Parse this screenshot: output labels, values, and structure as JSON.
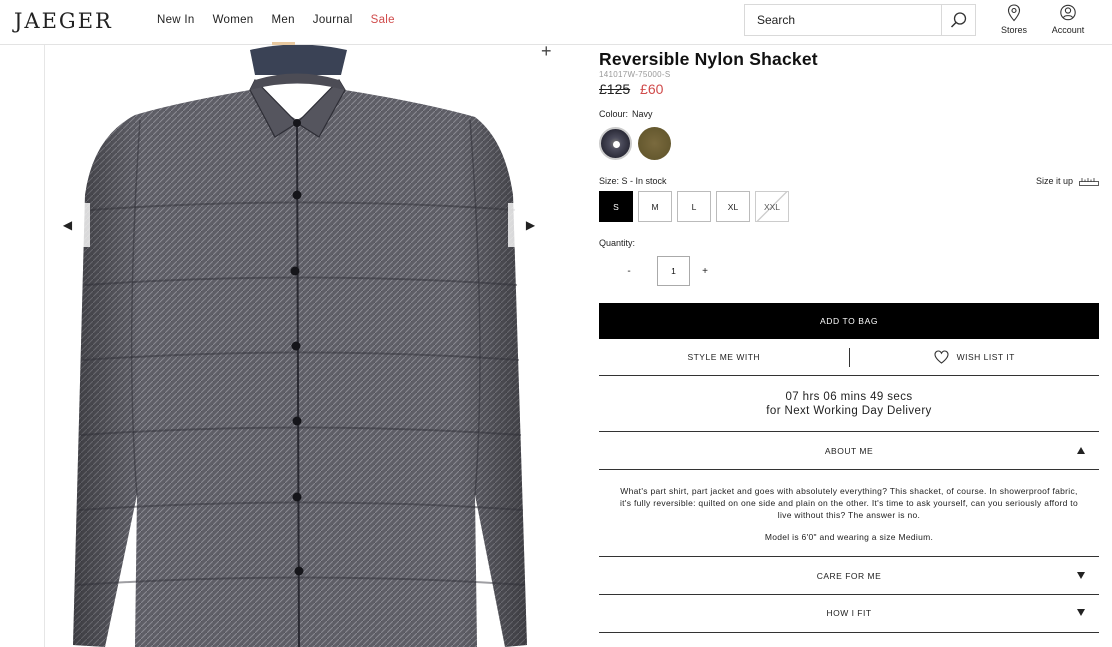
{
  "header": {
    "logo": "JAEGER",
    "nav": [
      {
        "label": "New In"
      },
      {
        "label": "Women"
      },
      {
        "label": "Men",
        "active": true
      },
      {
        "label": "Journal"
      },
      {
        "label": "Sale",
        "sale": true
      }
    ],
    "search_placeholder": "Search",
    "stores_label": "Stores",
    "account_label": "Account"
  },
  "gallery": {
    "prev_icon": "caret-left-icon",
    "next_icon": "caret-right-icon",
    "zoom_icon": "plus-icon"
  },
  "product": {
    "title": "Reversible Nylon Shacket",
    "sku": "141017W-75000-S",
    "price_old": "£125",
    "price_new": "£60",
    "colour_label": "Colour:",
    "colour_value": "Navy",
    "size_label": "Size: S - In stock",
    "size_it_up": "Size it up",
    "sizes": [
      "S",
      "M",
      "L",
      "XL",
      "XXL"
    ],
    "quantity_label": "Quantity:",
    "qty_minus": "-",
    "qty_value": "1",
    "qty_plus": "+",
    "add_to_bag": "ADD TO BAG",
    "style_me_with": "STYLE ME WITH",
    "wish_list_it": "WISH LIST IT",
    "delivery_line1": "07 hrs 06 mins 49 secs",
    "delivery_line2": "for Next Working Day Delivery",
    "about_me": "ABOUT ME",
    "about_text": "What's part shirt, part jacket and goes with absolutely everything? This shacket, of course. In showerproof fabric, it's fully reversible: quilted on one side and plain on the other. It's time to ask yourself, can you seriously afford to live without this? The answer is no.",
    "model_text": "Model is 6'0\" and wearing a size Medium.",
    "care_for_me": "CARE FOR ME",
    "how_i_fit": "HOW I FIT"
  },
  "colors": {
    "sale": "#d04b4b",
    "nav_active_underline": "#e8c9a0",
    "button_bg": "#000000"
  }
}
